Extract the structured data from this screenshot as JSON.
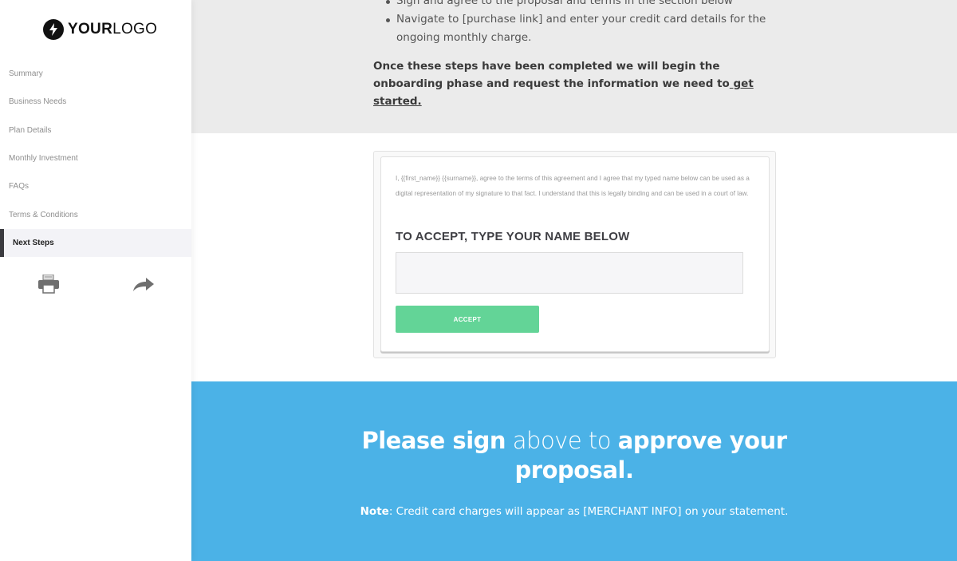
{
  "sidebar": {
    "logo": {
      "bold": "YOUR",
      "light": "LOGO",
      "icon": "lightning-bolt-icon"
    },
    "nav": [
      {
        "label": "Summary",
        "active": false
      },
      {
        "label": "Business Needs",
        "active": false
      },
      {
        "label": "Plan Details",
        "active": false
      },
      {
        "label": "Monthly Investment",
        "active": false
      },
      {
        "label": "FAQs",
        "active": false
      },
      {
        "label": "Terms & Conditions",
        "active": false
      },
      {
        "label": "Next Steps",
        "active": true
      }
    ],
    "actions": [
      {
        "name": "print",
        "icon": "printer-icon"
      },
      {
        "name": "share",
        "icon": "share-arrow-icon"
      }
    ]
  },
  "next_steps": {
    "bullets": [
      "Sign and agree to the proposal and terms in the section below",
      "Navigate to [purchase link] and enter your credit card details for the ongoing monthly charge."
    ],
    "completion_text": "Once these steps have been completed we will begin the onboarding phase and request the information we need to",
    "completion_link": " get started."
  },
  "signature": {
    "legal_text": "I, {{first_name}} {{surname}}, agree to the terms of this agreement and I agree that my typed name below can be used as a digital representation of my signature to that fact. I understand that this is legally binding and can be used in a court of law.",
    "heading": "TO ACCEPT, TYPE YOUR NAME BELOW",
    "name_value": "",
    "name_placeholder": "",
    "accept_label": "ACCEPT"
  },
  "cta": {
    "part1_bold": "Please sign",
    "part2_light": " above to ",
    "part3_bold": "approve your proposal.",
    "note_label": "Note",
    "note_text": ": Credit card charges will appear as [MERCHANT INFO] on your statement."
  },
  "colors": {
    "accent_blue": "#4bb2e7",
    "accept_green": "#63d497",
    "active_nav_bar": "#3a3a3f"
  }
}
